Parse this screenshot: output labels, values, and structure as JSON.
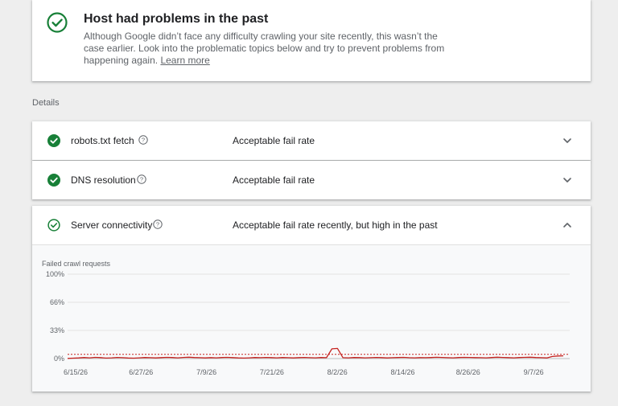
{
  "summary": {
    "title": "Host had problems in the past",
    "description": "Although Google didn’t face any difficulty crawling your site recently, this wasn’t the case earlier. Look into the problematic topics below and try to prevent problems from happening again.",
    "learn_more": "Learn more",
    "icon": "check-circle-icon",
    "accent_color": "#188038"
  },
  "details_label": "Details",
  "rows": [
    {
      "title": "robots.txt fetch",
      "status": "Acceptable fail rate",
      "icon": "check-circle-filled-icon",
      "expanded": false
    },
    {
      "title": "DNS resolution",
      "status": "Acceptable fail rate",
      "icon": "check-circle-filled-icon",
      "expanded": false
    },
    {
      "title": "Server connectivity",
      "status": "Acceptable fail rate recently, but high in the past",
      "icon": "check-circle-outline-icon",
      "expanded": true
    }
  ],
  "chart_data": {
    "type": "line",
    "title": "Failed crawl requests",
    "y_ticks": [
      "100%",
      "66%",
      "33%",
      "0%"
    ],
    "ylim": [
      0,
      100
    ],
    "x_tick_labels": [
      "6/15/26",
      "6/27/26",
      "7/9/26",
      "7/21/26",
      "8/2/26",
      "8/14/26",
      "8/26/26",
      "9/7/26"
    ],
    "x_start": "6/15/26",
    "x_end": "9/13/26",
    "threshold": 5,
    "series_color": "#c5221f",
    "series": [
      {
        "values": [
          0.2,
          0.5,
          0.8,
          1.2,
          0.9,
          1.4,
          1.1,
          0.6,
          0.9,
          1.3,
          1.0,
          0.7,
          0.5,
          0.9,
          1.2,
          1.0,
          0.8,
          1.1,
          1.4,
          1.2,
          0.9,
          1.3,
          1.6,
          1.2,
          1.0,
          0.8,
          1.1,
          0.9,
          1.2,
          1.4,
          1.1,
          0.8,
          0.6,
          0.9,
          1.2,
          1.0,
          1.3,
          1.1,
          0.9,
          1.2,
          1.0,
          0.8,
          1.1,
          1.3,
          1.0,
          0.9,
          1.2,
          1.0,
          11.5,
          12.0,
          1.0,
          0.9,
          1.2,
          1.1,
          0.9,
          1.0,
          1.3,
          1.1,
          0.8,
          1.0,
          1.2,
          1.4,
          1.0,
          0.9,
          1.1,
          1.0,
          1.2,
          1.5,
          1.3,
          1.0,
          0.9,
          1.2,
          1.4,
          1.3,
          1.1,
          1.0,
          0.9,
          1.2,
          1.6,
          1.3,
          1.1,
          0.9,
          1.2,
          1.4,
          1.6,
          1.2,
          1.0,
          0.8,
          2.5,
          3.0,
          3.2
        ]
      }
    ]
  }
}
